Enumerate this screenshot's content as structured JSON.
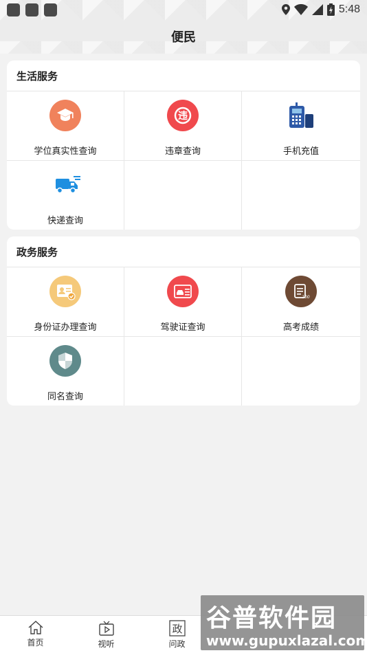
{
  "status_bar": {
    "time": "5:48"
  },
  "header": {
    "title": "便民"
  },
  "sections": [
    {
      "title": "生活服务",
      "items": [
        {
          "label": "学位真实性查询",
          "icon": "graduation-cap-icon",
          "color": "#f0825c"
        },
        {
          "label": "违章查询",
          "icon": "violation-icon",
          "color": "#f0494d"
        },
        {
          "label": "手机充值",
          "icon": "mobile-phone-icon",
          "color": "#2e5aa8"
        },
        {
          "label": "快递查询",
          "icon": "delivery-truck-icon",
          "color": "#1e8fe0"
        }
      ]
    },
    {
      "title": "政务服务",
      "items": [
        {
          "label": "身份证办理查询",
          "icon": "id-card-icon",
          "color": "#f5c97a"
        },
        {
          "label": "驾驶证查询",
          "icon": "driver-license-icon",
          "color": "#f0494d"
        },
        {
          "label": "高考成绩",
          "icon": "exam-score-icon",
          "color": "#6e4a34"
        },
        {
          "label": "同名查询",
          "icon": "same-name-icon",
          "color": "#5f8a8b"
        }
      ]
    }
  ],
  "bottom_nav": [
    {
      "label": "首页",
      "icon": "home-icon"
    },
    {
      "label": "视听",
      "icon": "tv-icon"
    },
    {
      "label": "问政",
      "icon": "zheng-icon",
      "glyph": "政"
    }
  ],
  "watermark": {
    "line1": "谷普软件园",
    "line2": "www.gupuxlazal.com"
  }
}
